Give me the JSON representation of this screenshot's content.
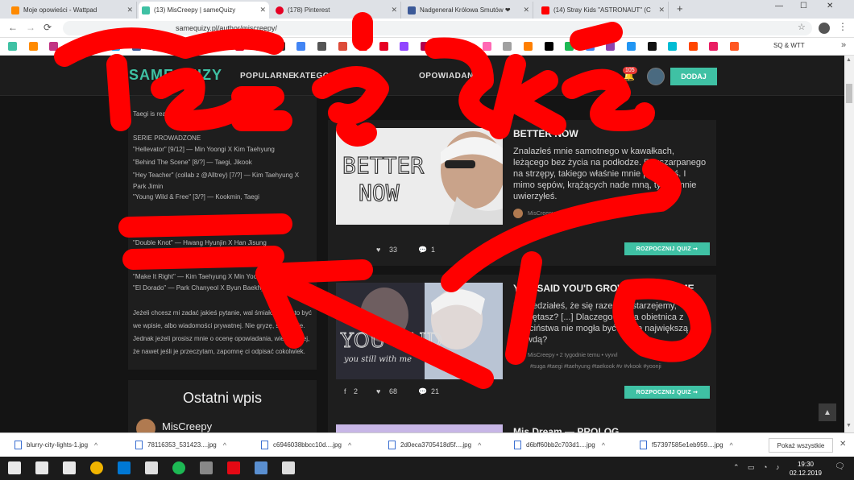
{
  "browser": {
    "tabs": [
      {
        "title": "Moje opowieści - Wattpad",
        "favicon_color": "#ff8a00"
      },
      {
        "title": "(13) MisCreepy | sameQuizy",
        "favicon_color": "#3fc1a4"
      },
      {
        "title": "(178) Pinterest",
        "favicon_color": "#e60023"
      },
      {
        "title": "Nadgenerał Królowa Smutów ❤",
        "favicon_color": "#3b5998"
      },
      {
        "title": "(14) Stray Kids \"ASTRONAUT\" (C",
        "favicon_color": "#ff0000"
      }
    ],
    "new_tab": "+",
    "window_controls": {
      "minimize": "—",
      "maximize": "☐",
      "close": "✕"
    },
    "nav": {
      "back": "←",
      "forward": "→",
      "reload": "⟳"
    },
    "address": "samequizy.pl/author/miscreepy/",
    "bookmark_folder": "SQ & WTT",
    "bookmark_colors": [
      "#3fc1a4",
      "#ff8a00",
      "#c13584",
      "#e60023",
      "#b00710",
      "#1da1f2",
      "#3b5998",
      "#3b5998",
      "#222222",
      "#00a000",
      "#fb7e14",
      "#e60023",
      "#0088cc",
      "#333333",
      "#4285f4",
      "#555555",
      "#dd4b39",
      "#ff0000",
      "#e60023",
      "#9146ff",
      "#b00050",
      "#ff9900",
      "#f0c000",
      "#ff69b4",
      "#a0a0a0",
      "#ff7f00",
      "#000000",
      "#1db954",
      "#4285f4",
      "#8e44ad",
      "#2196f3",
      "#111111",
      "#00bcd4",
      "#ff4500",
      "#e91e63",
      "#ff5722"
    ]
  },
  "site": {
    "logo": "SAMEQUIZY",
    "nav": [
      {
        "label": "POPULARNE"
      },
      {
        "label": "KATEGORIE"
      },
      {
        "label": "OPOWIADANIA"
      }
    ],
    "notifications": "105",
    "add_label": "DODAJ"
  },
  "sidebar": {
    "intro": "Taegi is real",
    "series_heading": "SERIE PROWADZONE",
    "series": [
      "\"Hellevator\" [9/12] — Min Yoongi X Kim Taehyung",
      "\"Behind The Scene\" [8/?] — Taegi, Jikook",
      "\"Hey Teacher\" (collab z @Alltrey) [7/?] — Kim Taehyung X",
      "Park Jimin",
      "\"Young Wild & Free\" [3/?] — Kookmin, Taegi"
    ],
    "planned": [
      "\"Double Knot\" — Hwang Hyunjin X Han Jisung",
      "\"Stigma\" — Kim Taehyung X Park Jimin",
      "\"Make It Right\" — Kim Taehyung X Min Yoongi",
      "\"El Dorado\" — Park Chanyeol X Byun Baekhyun"
    ],
    "note": "Jeżeli chcesz mi zadać jakieś pytanie, wal śmiało, może to być we wpisie, albo wiadomości prywatnej. Nie gryzę, spokojnie. Jednak jeżeli prosisz mnie o ocenę opowiadania, wiedz lepiej, że nawet jeśli je przeczytam, zapomnę ci odpisać cokolwiek.",
    "latest_title": "Ostatni wpis",
    "latest_author": "MisCreepy"
  },
  "cards": [
    {
      "thumb_text": [
        "BETTER",
        "NOW"
      ],
      "title": "BETTER NOW",
      "description": "Znalazłeś mnie samotnego w kawałkach, leżącego bez życia na podłodze. Rozszarpanego na strzępy, takiego właśnie mnie poznałeś. I mimo sępów, krążących nade mną, ty we mnie uwierzyłeś.",
      "meta": "MisCreepy • 7 dni temu",
      "tags": "",
      "shares": "",
      "likes": "33",
      "comments": "1",
      "quiz_label": "ROZPOCZNIJ QUIZ ➞"
    },
    {
      "thumb_text": [
        "YOU SAID",
        "you still with me"
      ],
      "title": "YOU SAID YOU'D GROW OLD WITH ME",
      "description": "Powiedziałeś, że się razem zestarzejemy, pamiętasz? [...] Dlaczego głupia obietnica z dzieciństwa nie mogła być naszą największą prawdą?",
      "meta": "MisCreepy • 2 tygodnie temu • vyvvl",
      "tags": "#suga #taegi #taehyung #taekook #v #vkook #yoonji",
      "shares": "2",
      "likes": "68",
      "comments": "21",
      "quiz_label": "ROZPOCZNIJ QUIZ ➞"
    }
  ],
  "card3_title": "Mis Dream — PROLOG",
  "downloads": {
    "items": [
      "blurry-city-lights-1.jpg",
      "78116353_531423....jpg",
      "c6946038bbcc10d....jpg",
      "2d0eca3705418d5f....jpg",
      "d6bff60bb2c703d1....jpg",
      "f57397585e1eb959....jpg"
    ],
    "show_all": "Pokaż wszystkie"
  },
  "taskbar": {
    "time": "19:30",
    "date": "02.12.2019",
    "app_colors": [
      "#ffffff",
      "#ffffff",
      "#ffffff",
      "#f0b400",
      "#0078d4",
      "#e0e0e0",
      "#1db954",
      "#888888",
      "#e50914",
      "#5a8fd0",
      "#dddddd"
    ]
  }
}
